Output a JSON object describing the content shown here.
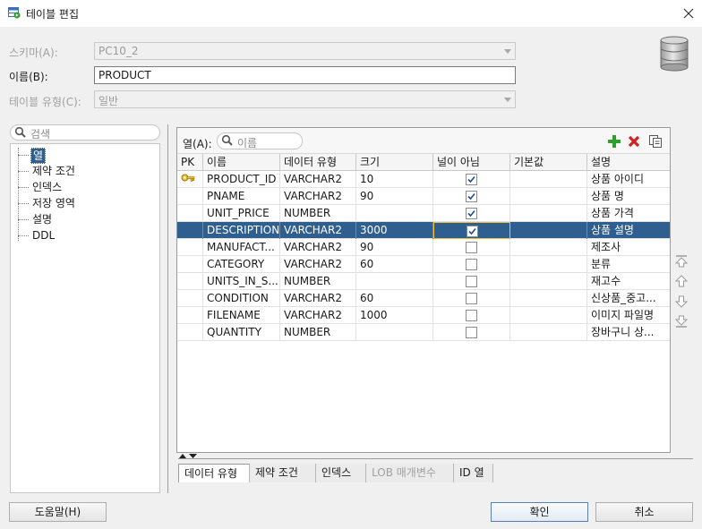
{
  "window": {
    "title": "테이블 편집",
    "close_glyph": "×"
  },
  "form": {
    "schema_label": "스키마(A):",
    "schema_value": "PC10_2",
    "name_label": "이름(B):",
    "name_value": "PRODUCT",
    "table_type_label": "테이블 유형(C):",
    "table_type_value": "일반"
  },
  "left_panel": {
    "search_placeholder": "검색",
    "items": [
      "열",
      "제약 조건",
      "인덱스",
      "저장 영역",
      "설명",
      "DDL"
    ],
    "selected": "열"
  },
  "columns_panel": {
    "label": "열(A):",
    "search_placeholder": "이름",
    "toolbar": {
      "add": "add-icon",
      "delete": "delete-icon",
      "copy": "copy-icon"
    },
    "headers": [
      "PK",
      "이름",
      "데이터 유형",
      "크기",
      "널이 아님",
      "기본값",
      "설명"
    ],
    "rows": [
      {
        "pk": true,
        "name": "PRODUCT_ID",
        "type": "VARCHAR2",
        "size": "10",
        "not_null": true,
        "default": "",
        "desc": "상품 아이디"
      },
      {
        "pk": false,
        "name": "PNAME",
        "type": "VARCHAR2",
        "size": "90",
        "not_null": true,
        "default": "",
        "desc": "상품 명"
      },
      {
        "pk": false,
        "name": "UNIT_PRICE",
        "type": "NUMBER",
        "size": "",
        "not_null": true,
        "default": "",
        "desc": "상품 가격"
      },
      {
        "pk": false,
        "name": "DESCRIPTION",
        "type": "VARCHAR2",
        "size": "3000",
        "not_null": true,
        "default": "",
        "desc": "상품 설명"
      },
      {
        "pk": false,
        "name": "MANUFACT...",
        "type": "VARCHAR2",
        "size": "90",
        "not_null": false,
        "default": "",
        "desc": "제조사"
      },
      {
        "pk": false,
        "name": "CATEGORY",
        "type": "VARCHAR2",
        "size": "60",
        "not_null": false,
        "default": "",
        "desc": "분류"
      },
      {
        "pk": false,
        "name": "UNITS_IN_S...",
        "type": "NUMBER",
        "size": "",
        "not_null": false,
        "default": "",
        "desc": "재고수"
      },
      {
        "pk": false,
        "name": "CONDITION",
        "type": "VARCHAR2",
        "size": "60",
        "not_null": false,
        "default": "",
        "desc": "신상품_중고..."
      },
      {
        "pk": false,
        "name": "FILENAME",
        "type": "VARCHAR2",
        "size": "1000",
        "not_null": false,
        "default": "",
        "desc": "이미지 파일명"
      },
      {
        "pk": false,
        "name": "QUANTITY",
        "type": "NUMBER",
        "size": "",
        "not_null": false,
        "default": "",
        "desc": "장바구니 상..."
      }
    ],
    "selected_row": 3
  },
  "bottom_tabs": [
    "데이터 유형",
    "제약 조건",
    "인덱스",
    "LOB 매개변수",
    "ID 열"
  ],
  "buttons": {
    "help": "도움말(H)",
    "ok": "확인",
    "cancel": "취소"
  },
  "colors": {
    "selection": "#2f5f8f",
    "add": "#2e9e2e",
    "delete": "#d32020"
  }
}
